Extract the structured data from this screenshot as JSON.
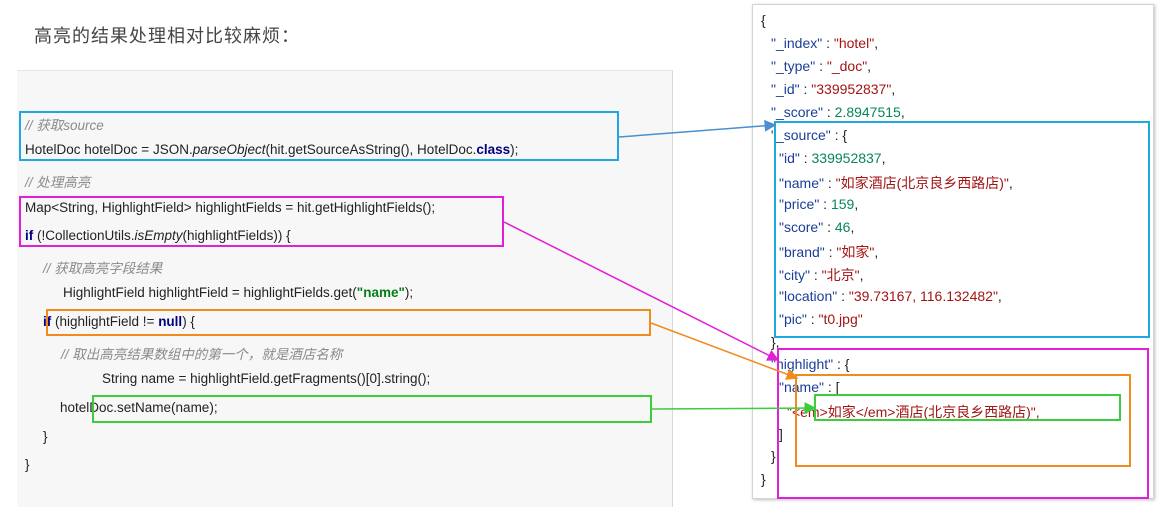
{
  "heading": "高亮的结果处理相对比较麻烦：",
  "code": {
    "comment_source": "// 获取source",
    "line_source": "HotelDoc hotelDoc = JSON.parseObject(hit.getSourceAsString(), HotelDoc.class);",
    "comment_highlight": "// 处理高亮",
    "line_map": "Map<String, HighlightField> highlightFields = hit.getHighlightFields();",
    "line_if_empty": "if (!CollectionUtils.isEmpty(highlightFields)) {",
    "comment_get_field": "// 获取高亮字段结果",
    "line_get_field": "HighlightField highlightField = highlightFields.get(\"name\");",
    "line_if_null": "if (highlightField != null) {",
    "comment_first": "// 取出高亮结果数组中的第一个，就是酒店名称",
    "line_name": "String name = highlightField.getFragments()[0].string();",
    "line_set": "hotelDoc.setName(name);",
    "brace_inner": "}",
    "brace_outer": "}"
  },
  "json": {
    "open": "{",
    "index_key": "\"_index\"",
    "index_val": "\"hotel\"",
    "type_key": "\"_type\"",
    "type_val": "\"_doc\"",
    "id_key": "\"_id\"",
    "id_val": "\"339952837\"",
    "score_key": "\"_score\"",
    "score_val": "2.8947515",
    "source_key": "\"_source\"",
    "f_id_key": "\"id\"",
    "f_id_val": "339952837",
    "f_name_key": "\"name\"",
    "f_name_val": "\"如家酒店(北京良乡西路店)\"",
    "f_price_key": "\"price\"",
    "f_price_val": "159",
    "f_score_key": "\"score\"",
    "f_score_val": "46",
    "f_brand_key": "\"brand\"",
    "f_brand_val": "\"如家\"",
    "f_city_key": "\"city\"",
    "f_city_val": "\"北京\"",
    "f_location_key": "\"location\"",
    "f_location_val": "\"39.73167, 116.132482\"",
    "f_pic_key": "\"pic\"",
    "f_pic_val": "\"t0.jpg\"",
    "highlight_key": "\"highlight\"",
    "hl_name_key": "\"name\"",
    "hl_frag": "\"<em>如家</em>酒店(北京良乡西路店)\","
  },
  "colors": {
    "blue": "#1ea7e0",
    "magenta": "#e020d8",
    "orange": "#f08c1e",
    "green": "#3ccc3c"
  }
}
